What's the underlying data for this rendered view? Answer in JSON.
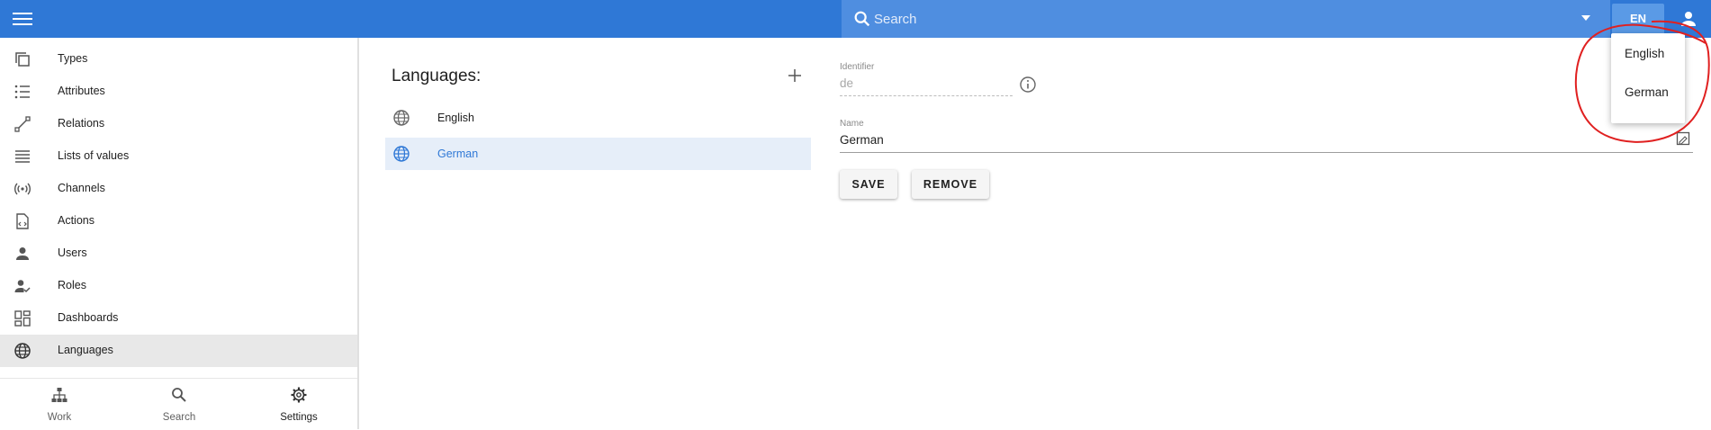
{
  "header": {
    "search_placeholder": "Search",
    "language_button": "EN"
  },
  "sidebar": {
    "items": [
      {
        "label": "Types",
        "icon": "types-icon"
      },
      {
        "label": "Attributes",
        "icon": "attributes-icon"
      },
      {
        "label": "Relations",
        "icon": "relations-icon"
      },
      {
        "label": "Lists of values",
        "icon": "lists-icon"
      },
      {
        "label": "Channels",
        "icon": "channels-icon"
      },
      {
        "label": "Actions",
        "icon": "actions-icon"
      },
      {
        "label": "Users",
        "icon": "user-icon"
      },
      {
        "label": "Roles",
        "icon": "roles-icon"
      },
      {
        "label": "Dashboards",
        "icon": "dashboards-icon"
      },
      {
        "label": "Languages",
        "icon": "globe-icon",
        "active": true
      }
    ]
  },
  "bottom_nav": {
    "items": [
      {
        "label": "Work",
        "icon": "work-icon"
      },
      {
        "label": "Search",
        "icon": "search-icon"
      },
      {
        "label": "Settings",
        "icon": "settings-icon",
        "active": true
      }
    ]
  },
  "languages": {
    "title": "Languages:",
    "items": [
      {
        "label": "English"
      },
      {
        "label": "German",
        "selected": true
      }
    ]
  },
  "form": {
    "identifier_label": "Identifier",
    "identifier_value": "de",
    "name_label": "Name",
    "name_value": "German",
    "save_label": "SAVE",
    "remove_label": "REMOVE"
  },
  "dropdown": {
    "options": [
      "English",
      "German"
    ]
  },
  "colors": {
    "primary": "#2f78d6",
    "search_bg": "#4f8ee0",
    "selected_row": "#e6eef9",
    "annotation": "#e02020"
  }
}
